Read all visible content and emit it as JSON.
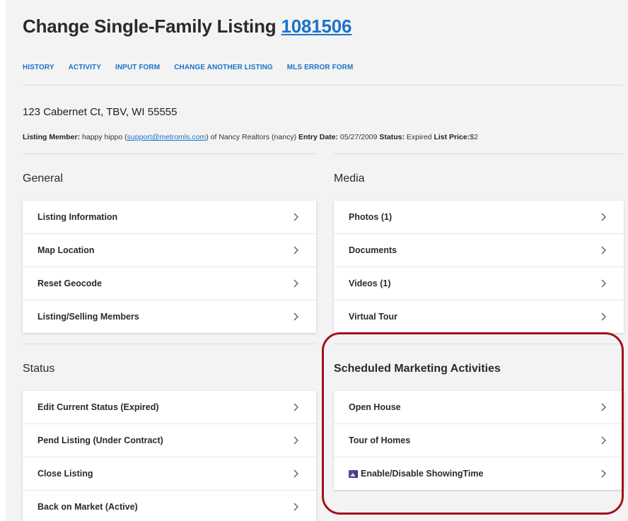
{
  "header": {
    "title": "Change Single-Family Listing",
    "listing_number": "1081506"
  },
  "nav": [
    "HISTORY",
    "ACTIVITY",
    "INPUT FORM",
    "CHANGE ANOTHER LISTING",
    "MLS ERROR FORM"
  ],
  "listing": {
    "address": "123 Cabernet Ct, TBV, WI 55555",
    "member_label": "Listing Member:",
    "member_name": "happy hippo (",
    "member_email": "support@metromls.com",
    "member_office": ") of Nancy Realtors (nancy)",
    "entry_date_label": "Entry Date:",
    "entry_date": "05/27/2009",
    "status_label": "Status:",
    "status": "Expired",
    "list_price_label": "List Price:",
    "list_price": "$2"
  },
  "sections": {
    "general": {
      "title": "General",
      "items": [
        "Listing Information",
        "Map Location",
        "Reset Geocode",
        "Listing/Selling Members"
      ]
    },
    "media": {
      "title": "Media",
      "items": [
        "Photos (1)",
        "Documents",
        "Videos (1)",
        "Virtual Tour"
      ]
    },
    "status": {
      "title": "Status",
      "items": [
        "Edit Current Status (Expired)",
        "Pend Listing (Under Contract)",
        "Close Listing",
        "Back on Market (Active)"
      ]
    },
    "marketing": {
      "title": "Scheduled Marketing Activities",
      "items": [
        "Open House",
        "Tour of Homes",
        "Enable/Disable ShowingTime"
      ]
    }
  },
  "icons": {
    "chevron": "chevron-right-icon",
    "showingtime": "showingtime-icon"
  },
  "colors": {
    "link": "#1a73c8",
    "highlight": "#a3121b",
    "background": "#f3f3f3"
  }
}
